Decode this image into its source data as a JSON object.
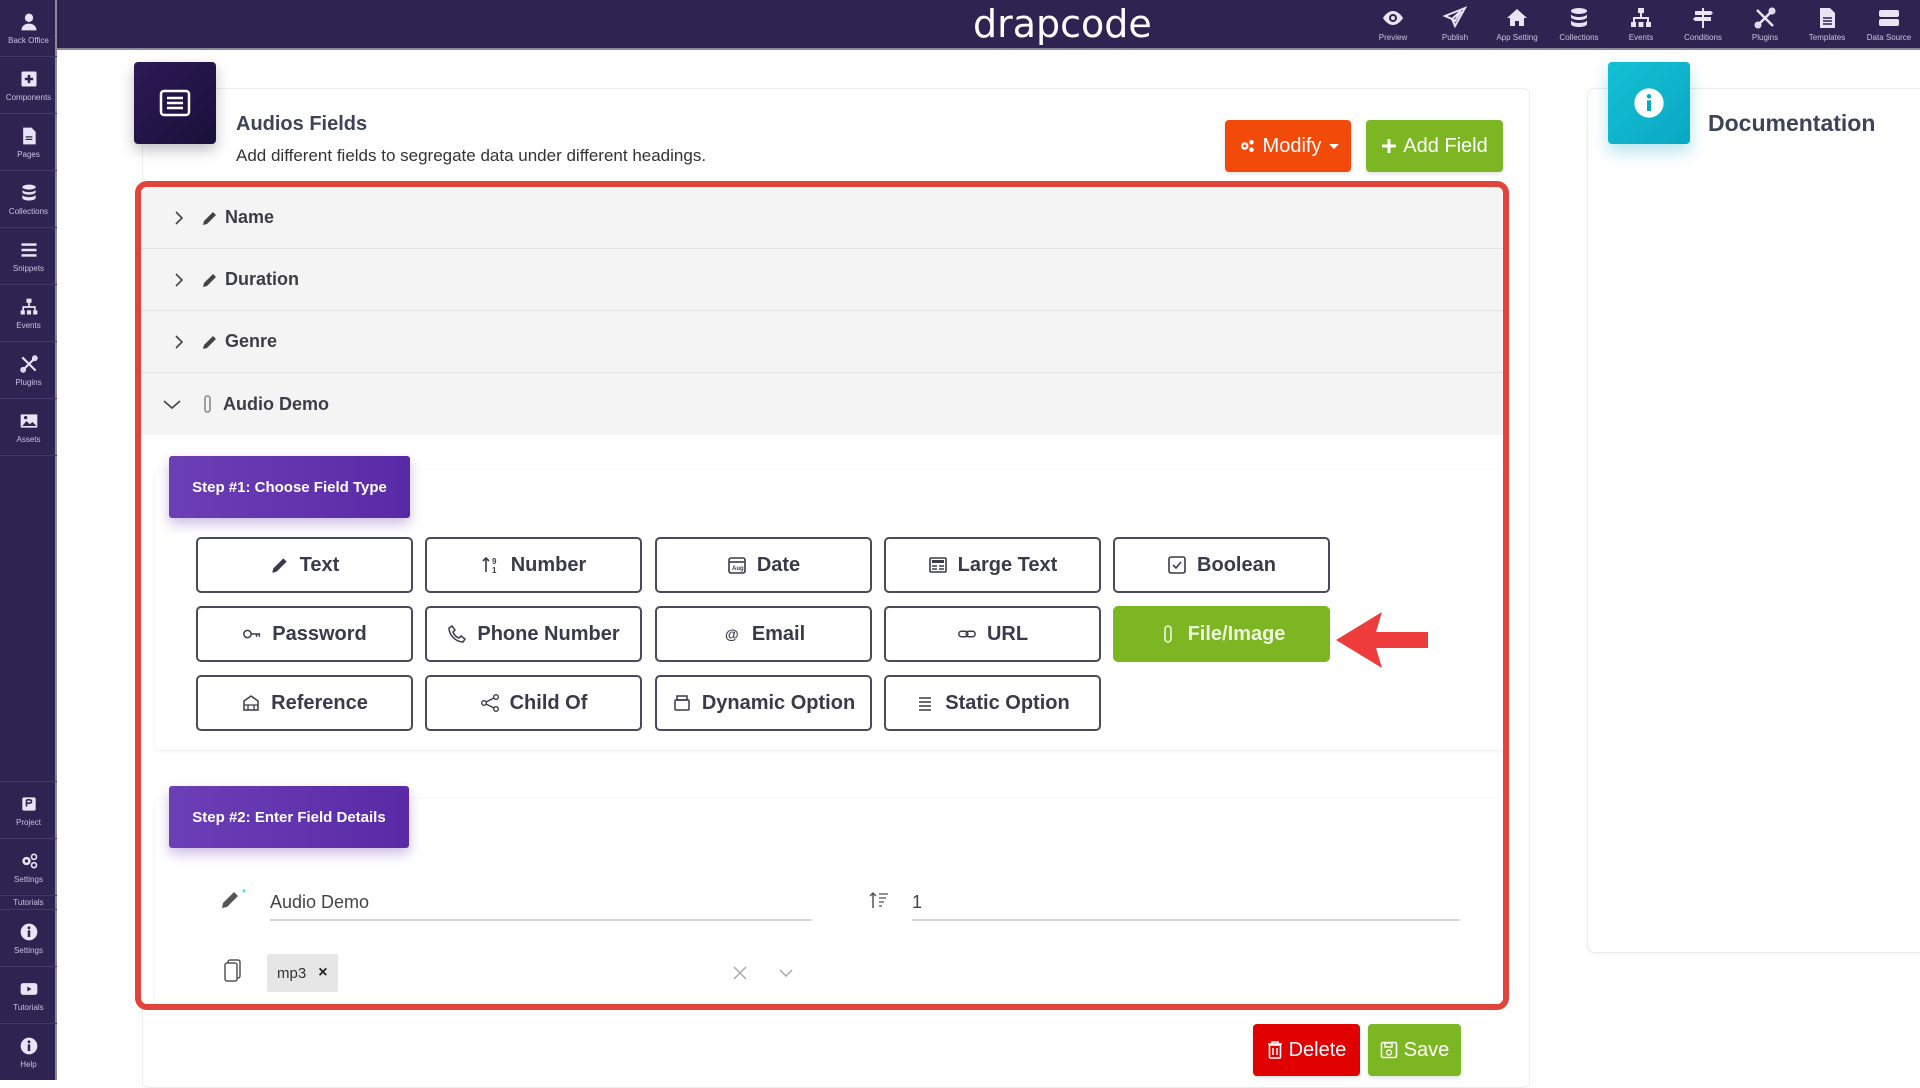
{
  "app": {
    "logo": "drapcode"
  },
  "topnav": [
    {
      "label": "Preview",
      "icon": "eye-icon"
    },
    {
      "label": "Publish",
      "icon": "paper-plane-icon"
    },
    {
      "label": "App Setting",
      "icon": "home-icon"
    },
    {
      "label": "Collections",
      "icon": "database-icon"
    },
    {
      "label": "Events",
      "icon": "sitemap-icon"
    },
    {
      "label": "Conditions",
      "icon": "signpost-icon"
    },
    {
      "label": "Plugins",
      "icon": "tools-icon"
    },
    {
      "label": "Templates",
      "icon": "file-icon"
    },
    {
      "label": "Data Source",
      "icon": "server-icon"
    }
  ],
  "sidebar": {
    "top": [
      {
        "label": "Back Office",
        "icon": "user-icon"
      },
      {
        "label": "Components",
        "icon": "plus-square-icon"
      },
      {
        "label": "Pages",
        "icon": "file-icon"
      },
      {
        "label": "Collections",
        "icon": "database-icon"
      },
      {
        "label": "Snippets",
        "icon": "bars-icon"
      },
      {
        "label": "Events",
        "icon": "sitemap-icon"
      },
      {
        "label": "Plugins",
        "icon": "tools-icon"
      },
      {
        "label": "Assets",
        "icon": "image-icon"
      }
    ],
    "bottom": [
      {
        "label": "Project",
        "icon": "project-icon"
      },
      {
        "label": "Settings",
        "icon": "cogs-icon"
      },
      {
        "label": "Settings",
        "icon": "info-icon",
        "extra_above": "Tutorials"
      },
      {
        "label": "Tutorials",
        "icon": "video-icon"
      },
      {
        "label": "Help",
        "icon": "info-icon"
      }
    ]
  },
  "header": {
    "title": "Audios Fields",
    "subtitle": "Add different fields to segregate data under different headings.",
    "modify_label": "Modify",
    "add_field_label": "Add Field"
  },
  "fields": [
    {
      "label": "Name",
      "icon": "pencil-icon",
      "expanded": false
    },
    {
      "label": "Duration",
      "icon": "pencil-icon",
      "expanded": false
    },
    {
      "label": "Genre",
      "icon": "pencil-icon",
      "expanded": false
    },
    {
      "label": "Audio Demo",
      "icon": "paperclip-icon",
      "expanded": true
    }
  ],
  "step1": {
    "label": "Step #1: Choose Field Type",
    "types": [
      {
        "label": "Text",
        "icon": "pencil-icon"
      },
      {
        "label": "Number",
        "icon": "sort-numeric-icon"
      },
      {
        "label": "Date",
        "icon": "calendar-icon"
      },
      {
        "label": "Large Text",
        "icon": "newspaper-icon"
      },
      {
        "label": "Boolean",
        "icon": "checkbox-icon"
      },
      {
        "label": "Password",
        "icon": "key-icon"
      },
      {
        "label": "Phone Number",
        "icon": "phone-icon"
      },
      {
        "label": "Email",
        "icon": "at-icon"
      },
      {
        "label": "URL",
        "icon": "link-icon"
      },
      {
        "label": "File/Image",
        "icon": "paperclip-icon",
        "selected": true
      },
      {
        "label": "Reference",
        "icon": "reference-icon"
      },
      {
        "label": "Child Of",
        "icon": "share-icon"
      },
      {
        "label": "Dynamic Option",
        "icon": "box-icon"
      },
      {
        "label": "Static Option",
        "icon": "list-icon"
      }
    ]
  },
  "step2": {
    "label": "Step #2: Enter Field Details",
    "field_name": "Audio Demo",
    "order": "1",
    "file_types": [
      "mp3"
    ]
  },
  "footer": {
    "delete_label": "Delete",
    "save_label": "Save"
  },
  "documentation": {
    "title": "Documentation"
  },
  "colors": {
    "brand": "#2f2352",
    "modify": "#f24a08",
    "add": "#7cb623",
    "selected": "#7cb623",
    "delete": "#e00000",
    "highlight_frame": "#e2433a",
    "step_badge": "#5a2aa6",
    "doc_icon": "#13c0d4"
  }
}
